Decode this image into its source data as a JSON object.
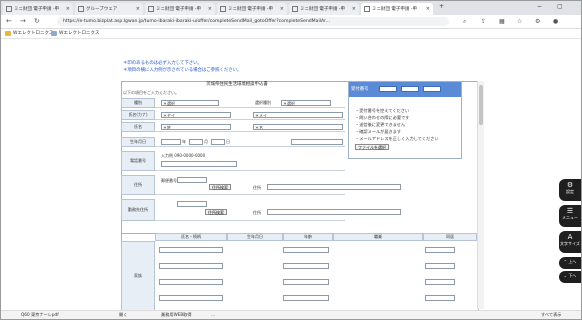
{
  "browser": {
    "tabs": [
      {
        "title": "ミニ財団 電子申請 -申"
      },
      {
        "title": "グループウェア"
      },
      {
        "title": "ミニ財団 電子申請 -申"
      },
      {
        "title": "ミニ財団 電子申請 -申"
      },
      {
        "title": "ミニ財団 電子申請 -申"
      },
      {
        "title": "ミニ財団 電子申請 -申"
      }
    ],
    "new_tab_label": "+",
    "url": "https://e-tumo.bizplat.asp.lgwan.jp/tumo-ibaraki-ibaraki-u/offer/completeSendMail_gotoOffer?completeSendMailAr...",
    "bookmarks": [
      {
        "label": "Wエレクトロニクス"
      },
      {
        "label": "Wエレクトロニクス"
      }
    ]
  },
  "page": {
    "notes": [
      "＊印のあるものは必ず入力して下さい。",
      "＊項目の横に入力例が示されている場合はご参照ください。"
    ],
    "form_title": "茨城県住民生活環境相談申込書",
    "form_subtitle": "以下の項目をご入力ください。",
    "fields": [
      {
        "label": "種別",
        "select": "＊選択",
        "label2": "選択種別",
        "select2": "＊選択"
      },
      {
        "label": "氏名(カナ)",
        "inp1": "＊セイ",
        "inp2": "＊メイ"
      },
      {
        "label": "氏名",
        "inp1": "＊姓",
        "inp2": "＊名"
      },
      {
        "label": "生年月日",
        "v1": "年",
        "v2": "月",
        "v3": "日"
      },
      {
        "label": "電話番号",
        "hint": "入力例 090-0000-0000"
      },
      {
        "label": "住所",
        "zip_label": "郵便番号",
        "search_btn": "住所検索",
        "addr_label": "住所"
      },
      {
        "label": "勤務先住所",
        "search_btn": "住所検索",
        "addr_label": "住所"
      }
    ],
    "right_panel": {
      "header": "受付番号",
      "lines": [
        "・受付番号を控えてください",
        "・問い合わせの際に必要です",
        "・送信後に変更できません",
        "・確認メールが届きます",
        "・メールアドレスを正しく入力してください"
      ],
      "button": "ファイルを選択"
    },
    "grid_headers": [
      "氏名・続柄",
      "生年月日",
      "年齢",
      "職業",
      "同居"
    ],
    "grid_row_label": "家族"
  },
  "side_widgets": [
    {
      "icon": "⚙",
      "label": "設定"
    },
    {
      "icon": "☰",
      "label": "メニュー"
    },
    {
      "icon": "A",
      "label": "文字サイズ"
    },
    {
      "icon": "⌃",
      "label": "上へ"
    },
    {
      "icon": "⌄",
      "label": "下へ"
    }
  ],
  "taskbar": {
    "items": [
      "Q60 東京ナーレpdf",
      "開く",
      "業務用WEB取得",
      "…"
    ],
    "right": "すべて表示"
  },
  "colors": {
    "accent": "#5b8bd6",
    "note_blue": "#1f55c8",
    "tab_bg": "#dfe3e8"
  }
}
